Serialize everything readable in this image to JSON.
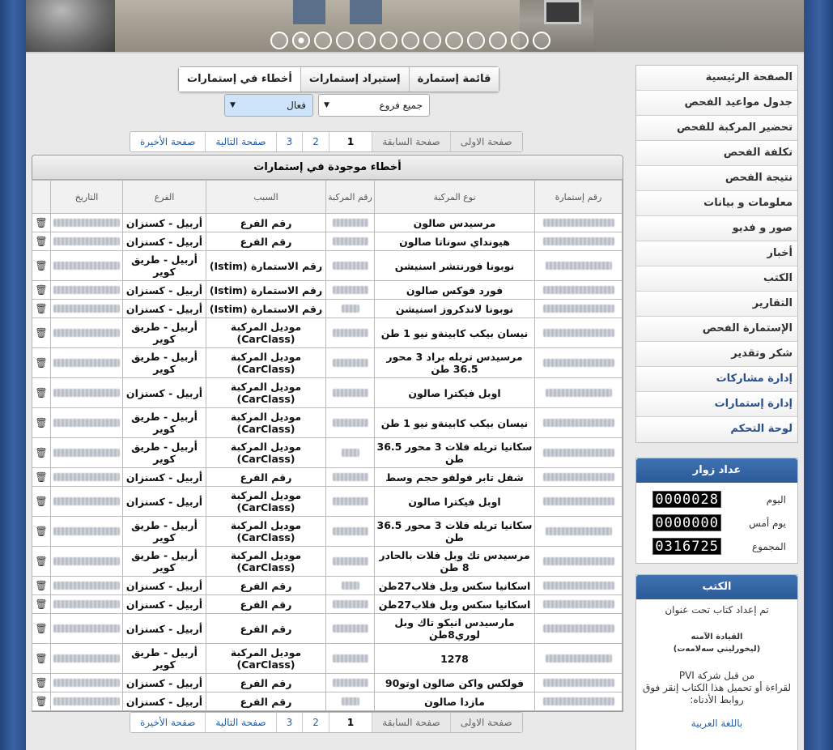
{
  "banner": {
    "slide_count": 13,
    "active_slide": 2
  },
  "tabs": [
    {
      "label": "قائمة إستمارة",
      "active": false
    },
    {
      "label": "إستيراد إستمارات",
      "active": false
    },
    {
      "label": "أخطاء في إستمارات",
      "active": true
    }
  ],
  "filters": {
    "branch": "جميع فروع",
    "status": "فعال"
  },
  "pager": {
    "first": "صفحة الاولى",
    "prev": "صفحة السابقة",
    "pages": [
      "1",
      "2",
      "3"
    ],
    "next": "صفحة التالية",
    "last": "صفحة الأخيرة"
  },
  "panel": {
    "title": "أخطاء موجودة في إستمارات"
  },
  "table": {
    "headers": [
      "رقم إستمارة",
      "نوع المركبة",
      "رقم المركبة",
      "السبب",
      "الفرع",
      "التاريخ"
    ],
    "rows": [
      {
        "type": "مرسيدس صالون",
        "reason": "رقم الفرع",
        "branch": "أربيل - كسنزان"
      },
      {
        "type": "هيونداي سوناتا صالون",
        "reason": "رقم الفرع",
        "branch": "أربيل - كسنزان"
      },
      {
        "type": "نوبونا فورنتشر اسنيشن",
        "reason": "رقم الاستمارة (Istim)",
        "branch": "أربيل - طريق كوير"
      },
      {
        "type": "فورد فوكس صالون",
        "reason": "رقم الاستمارة (Istim)",
        "branch": "أربيل - كسنزان"
      },
      {
        "type": "نوبونا لاندكروز اسنيشن",
        "reason": "رقم الاستمارة (Istim)",
        "branch": "أربيل - كسنزان"
      },
      {
        "type": "نيسان بيكب كابينةو نيو 1 طن",
        "reason": "موديل المركبة (CarClass)",
        "branch": "أربيل - طريق كوير"
      },
      {
        "type": "مرسيدس تريله براد 3 محور 36.5 طن",
        "reason": "موديل المركبة (CarClass)",
        "branch": "أربيل - طريق كوير"
      },
      {
        "type": "اوبل فيكترا صالون",
        "reason": "موديل المركبة (CarClass)",
        "branch": "أربيل - كسنزان"
      },
      {
        "type": "نيسان بيكب كابينةو نيو 1 طن",
        "reason": "موديل المركبة (CarClass)",
        "branch": "أربيل - طريق كوير"
      },
      {
        "type": "سكانيا تريله فلات 3 محور 36.5 طن",
        "reason": "موديل المركبة (CarClass)",
        "branch": "أربيل - طريق كوير"
      },
      {
        "type": "شفل تابر فولفو حجم وسط",
        "reason": "رقم الفرع",
        "branch": "أربيل - كسنزان"
      },
      {
        "type": "اوبل فيكترا صالون",
        "reason": "موديل المركبة (CarClass)",
        "branch": "أربيل - كسنزان"
      },
      {
        "type": "سكانيا تريله فلات 3 محور 36.5 طن",
        "reason": "موديل المركبة (CarClass)",
        "branch": "أربيل - طريق كوير"
      },
      {
        "type": "مرسيدس تك وبل فلات بالحادر 8 طن",
        "reason": "موديل المركبة (CarClass)",
        "branch": "أربيل - طريق كوير"
      },
      {
        "type": "اسكانيا سكس وبل فلاب27طن",
        "reason": "رقم الفرع",
        "branch": "أربيل - كسنزان"
      },
      {
        "type": "اسكانيا سكس وبل فلاب27طن",
        "reason": "رقم الفرع",
        "branch": "أربيل - كسنزان"
      },
      {
        "type": "مارسيدس انيكو تاك وبل لوري8طن",
        "reason": "رقم الفرع",
        "branch": "أربيل - كسنزان"
      },
      {
        "type": "1278",
        "reason": "موديل المركبة (CarClass)",
        "branch": "أربيل - طريق كوير"
      },
      {
        "type": "فولكس واكن صالون اوتو90",
        "reason": "رقم الفرع",
        "branch": "أربيل - كسنزان"
      },
      {
        "type": "مازدا صالون",
        "reason": "رقم الفرع",
        "branch": "أربيل - كسنزان"
      }
    ]
  },
  "sidebar": {
    "menu": [
      "الصفحة الرئيسية",
      "جدول مواعيد الفحص",
      "تحضير المركبة للفحص",
      "تكلفة الفحص",
      "نتيجة الفحص",
      "معلومات و بيانات",
      "صور و فديو",
      "أخبار",
      "الكتب",
      "التقارير",
      "الإستمارة الفحص",
      "شكر وتقدير"
    ],
    "admin_menu": [
      "إدارة مشاركات",
      "إدارة إستمارات",
      "لوحة التحكم"
    ],
    "visitors": {
      "title": "عداد زوار",
      "rows": [
        {
          "label": "اليوم",
          "value": "0000028"
        },
        {
          "label": "يوم أمس",
          "value": "0000000"
        },
        {
          "label": "المجموع",
          "value": "0316725"
        }
      ]
    },
    "books": {
      "title": "الكتب",
      "intro": "تم إعداد كتاب تحت عنوان",
      "book_title": "القيادة الآمنه",
      "book_subtitle": "(ليخورليني سەلامەت)",
      "publisher": "من قبل شركة PVI",
      "instructions": "لقراءة أو تحميل هذا الكتاب إنقر فوق روابط الأدناه:",
      "link_arabic": "باللغة العربية"
    }
  },
  "colors": {
    "header_blue": "#2c5a97",
    "link_blue": "#1f5fa6",
    "selected_filter": "#cde4fb"
  }
}
